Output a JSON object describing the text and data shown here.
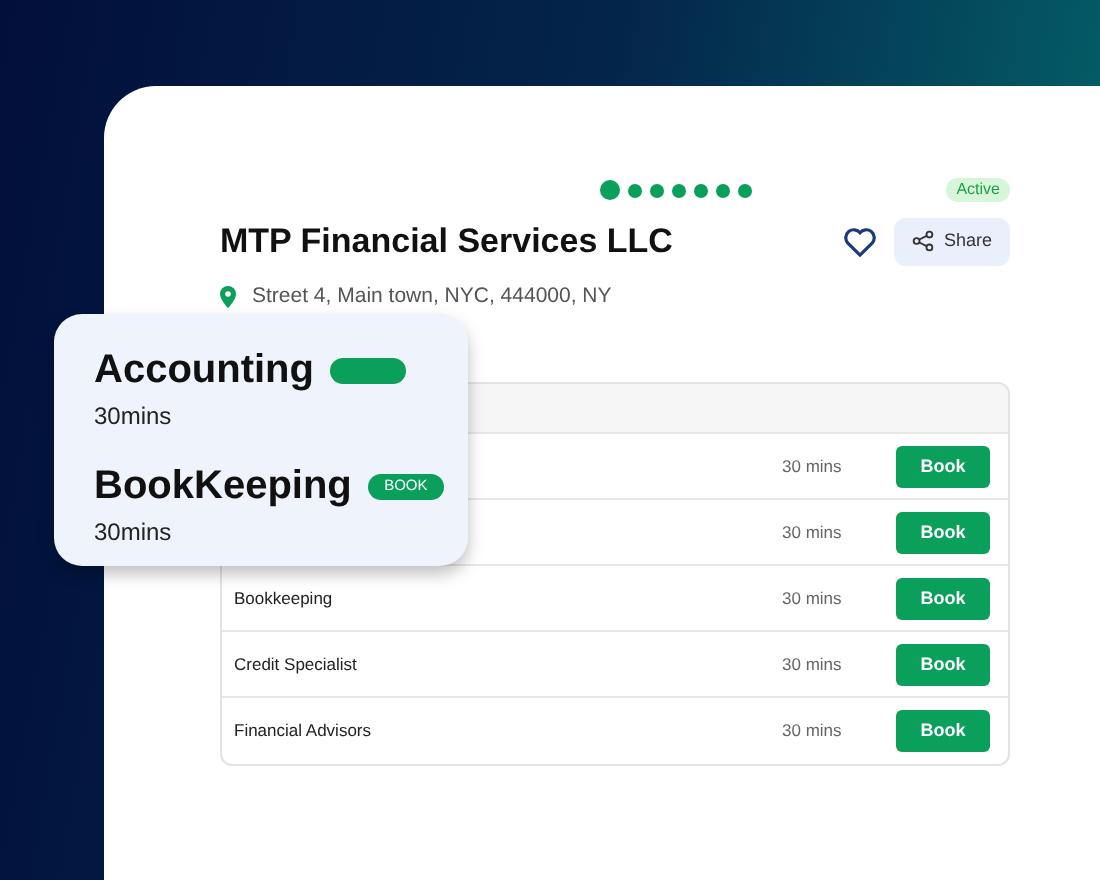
{
  "carousel": {
    "dots": [
      {
        "selected": true
      },
      {
        "selected": false
      },
      {
        "selected": false
      },
      {
        "selected": false
      },
      {
        "selected": false
      },
      {
        "selected": false
      },
      {
        "selected": false
      }
    ]
  },
  "status_badge": "Active",
  "business": {
    "name": "MTP Financial Services LLC",
    "address": "Street 4, Main town, NYC, 444000, NY",
    "favorite": false,
    "share_label": "Share"
  },
  "services": [
    {
      "duration": "30 mins",
      "action": "Book"
    },
    {
      "duration": "30 mins",
      "action": "Book"
    },
    {
      "name": "Bookkeeping",
      "duration": "30 mins",
      "action": "Book"
    },
    {
      "name": "Credit Specialist",
      "duration": "30 mins",
      "action": "Book"
    },
    {
      "name": "Financial Advisors",
      "duration": "30 mins",
      "action": "Book"
    }
  ],
  "popup": [
    {
      "title": "Accounting",
      "duration": "30mins"
    },
    {
      "title": "BookKeeping",
      "duration": "30mins",
      "badge": "BOOK"
    }
  ]
}
